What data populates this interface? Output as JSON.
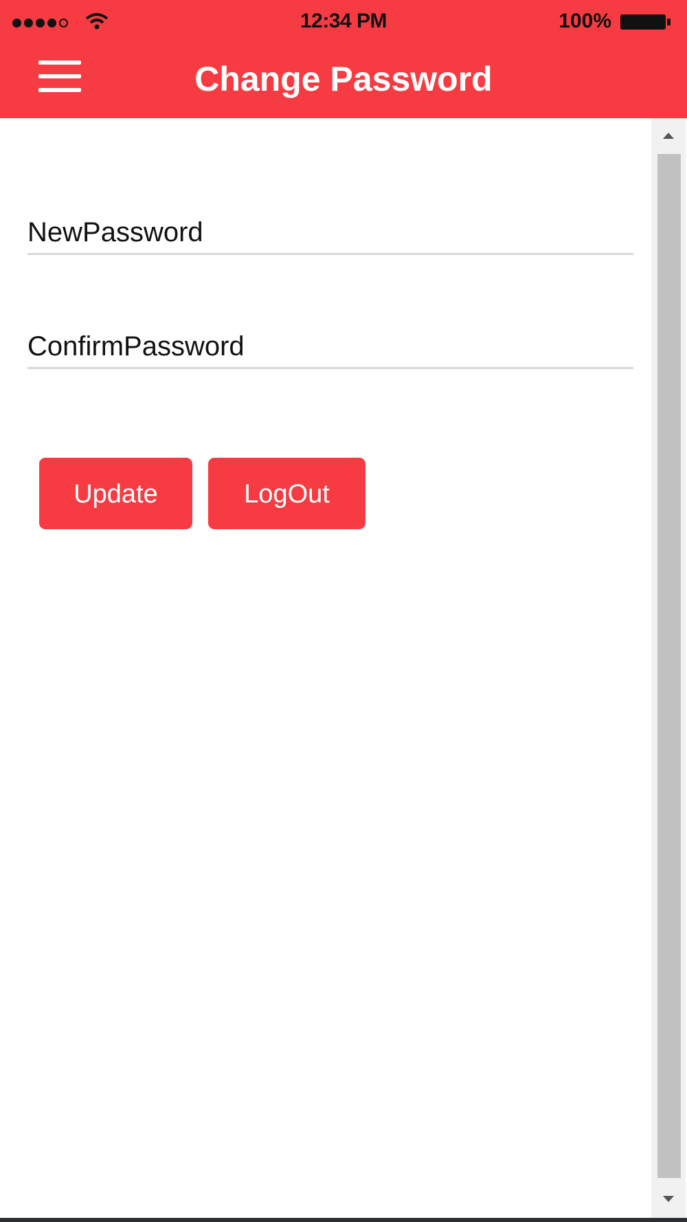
{
  "status_bar": {
    "time": "12:34 PM",
    "battery_percent": "100%",
    "signal_icon": "signal-dots-icon",
    "wifi_icon": "wifi-icon",
    "battery_icon": "battery-icon"
  },
  "header": {
    "title": "Change Password",
    "menu_icon": "hamburger-menu-icon",
    "background_color": "#f63c42"
  },
  "form": {
    "new_password": {
      "placeholder": "NewPassword",
      "value": ""
    },
    "confirm_password": {
      "placeholder": "ConfirmPassword",
      "value": ""
    }
  },
  "buttons": {
    "update_label": "Update",
    "logout_label": "LogOut",
    "button_color": "#f63c42"
  },
  "scrollbar": {
    "up_icon": "scroll-up-arrow-icon",
    "down_icon": "scroll-down-arrow-icon"
  }
}
